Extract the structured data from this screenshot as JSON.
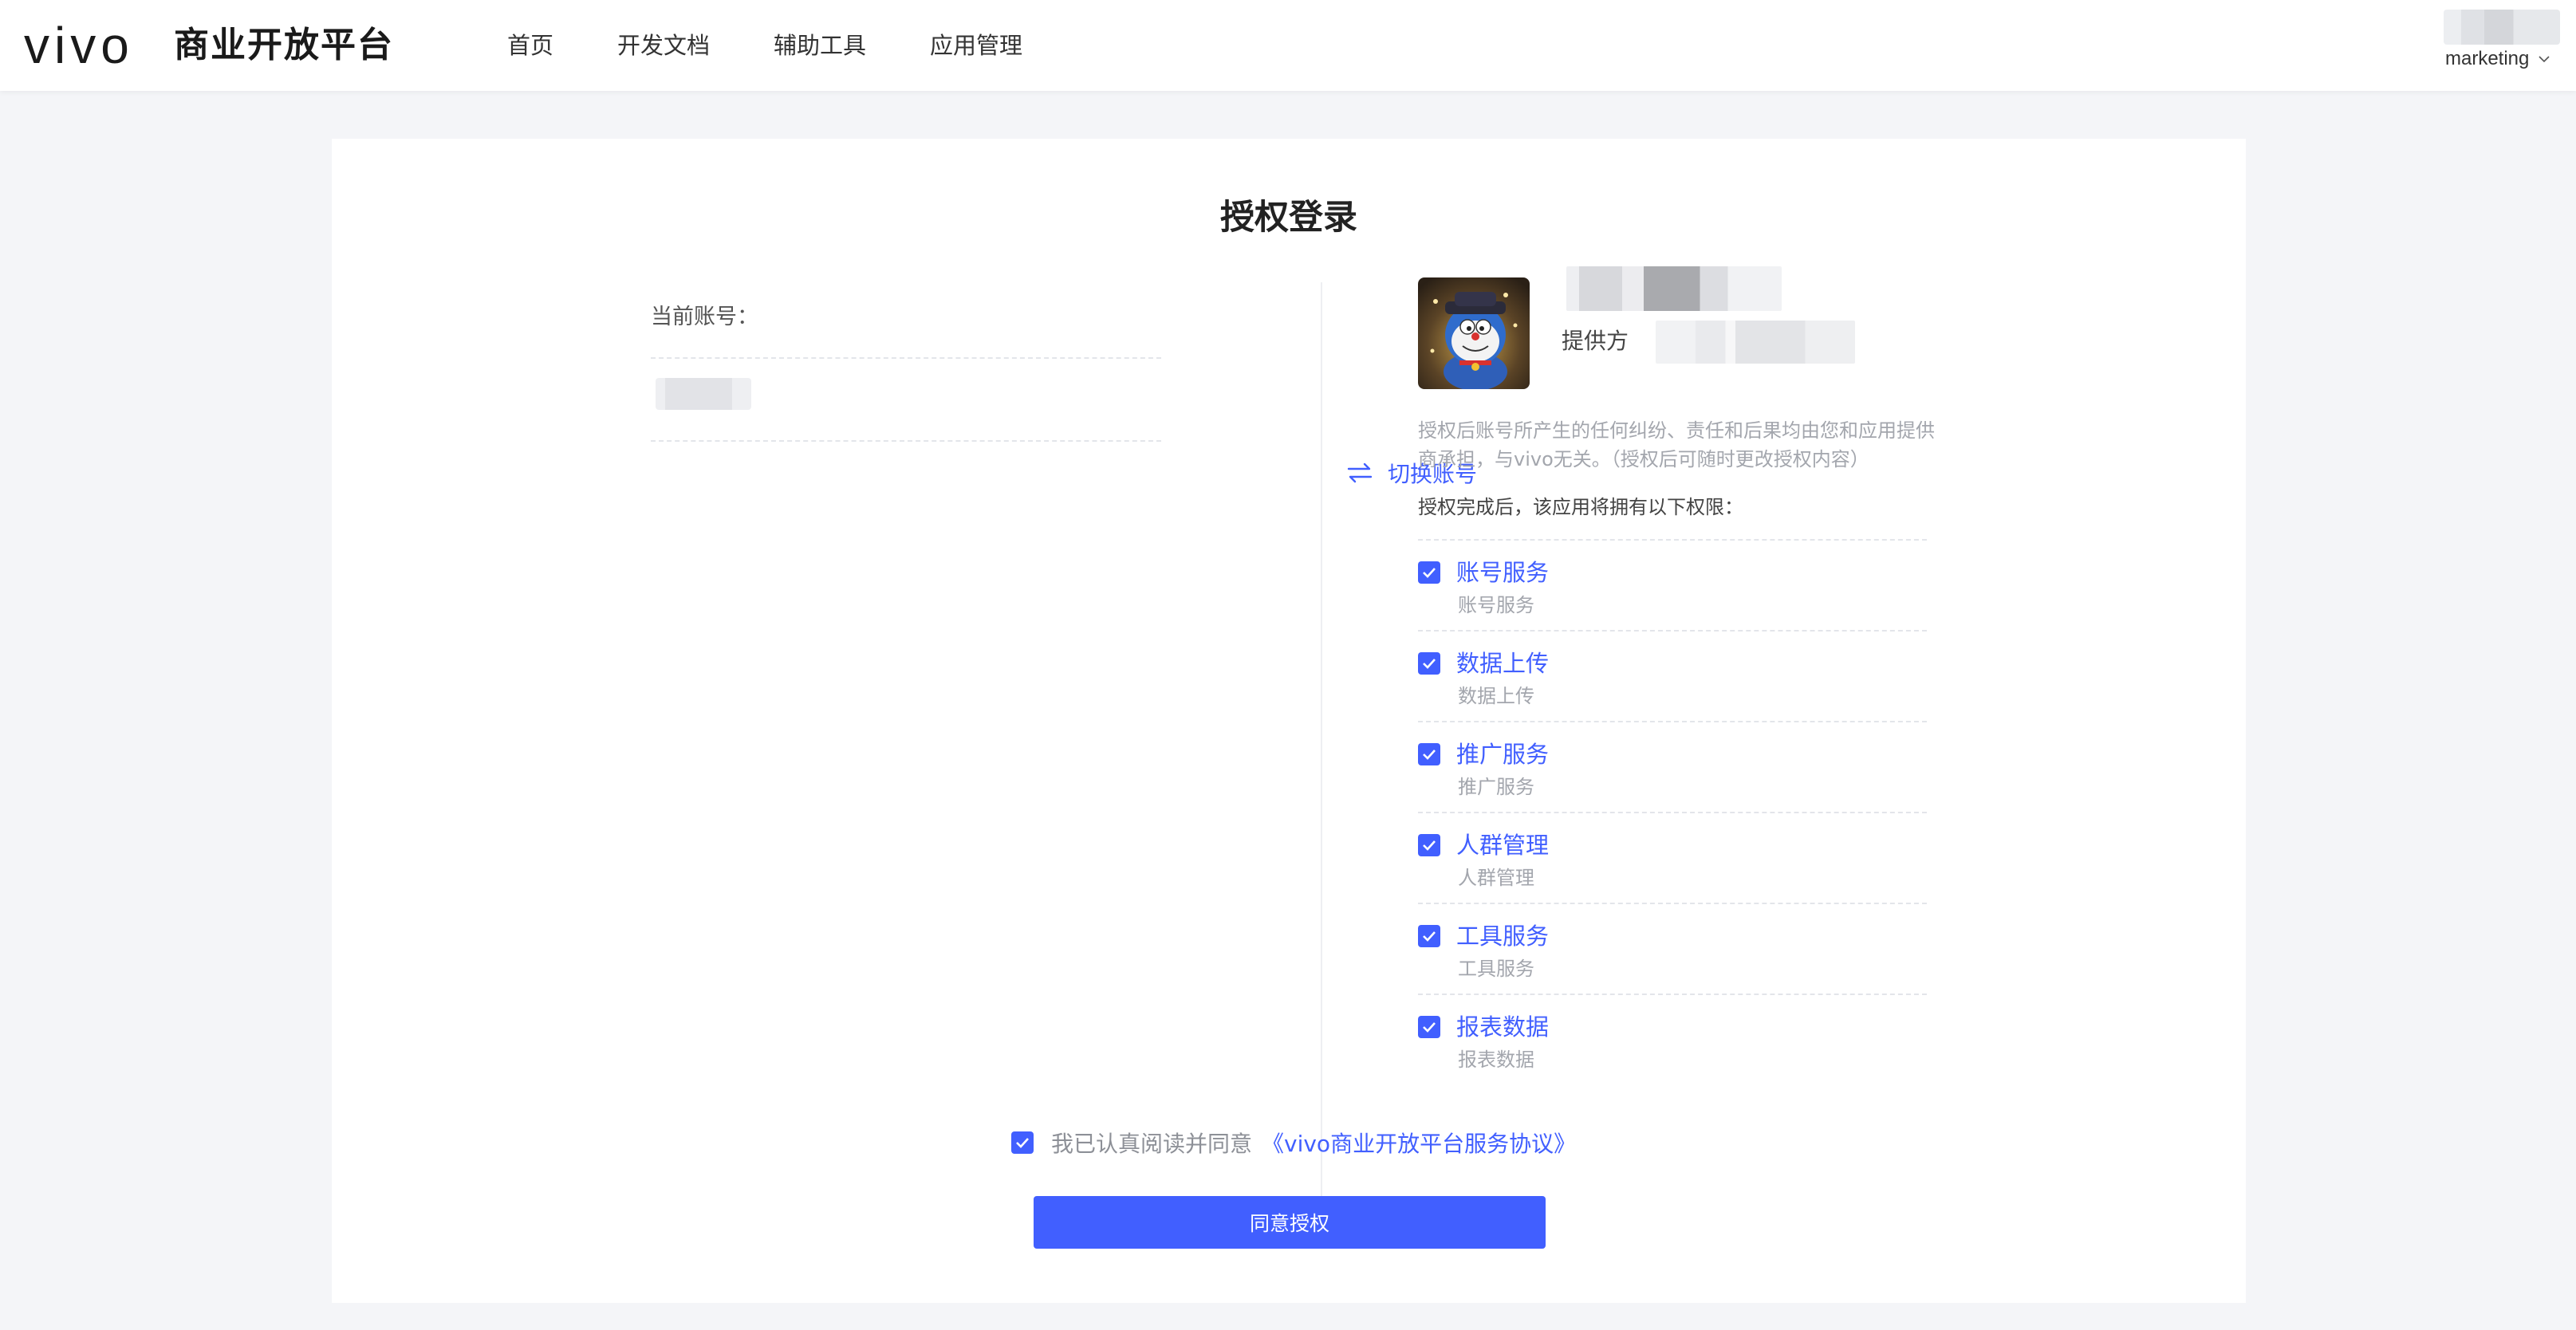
{
  "header": {
    "logo_text": "vivo",
    "platform_title": "商业开放平台",
    "nav": [
      {
        "label": "首页"
      },
      {
        "label": "开发文档"
      },
      {
        "label": "辅助工具"
      },
      {
        "label": "应用管理"
      }
    ],
    "user": "marketing"
  },
  "page": {
    "title": "授权登录",
    "current_account_label": "当前账号：",
    "switch_account_label": "切换账号",
    "provider_label": "提供方",
    "disclaimer": "授权后账号所产生的任何纠纷、责任和后果均由您和应用提供商承担，与vivo无关。（授权后可随时更改授权内容）",
    "permissions_heading": "授权完成后，该应用将拥有以下权限：",
    "permissions": [
      {
        "title": "账号服务",
        "desc": "账号服务"
      },
      {
        "title": "数据上传",
        "desc": "数据上传"
      },
      {
        "title": "推广服务",
        "desc": "推广服务"
      },
      {
        "title": "人群管理",
        "desc": "人群管理"
      },
      {
        "title": "工具服务",
        "desc": "工具服务"
      },
      {
        "title": "报表数据",
        "desc": "报表数据"
      }
    ],
    "agree_text": "我已认真阅读并同意",
    "agree_link": "《vivo商业开放平台服务协议》",
    "agree_button": "同意授权"
  },
  "colors": {
    "accent": "#415fff",
    "background": "#f4f5f8",
    "muted_text": "#a3a6ad"
  },
  "icons": [
    "switch-icon",
    "check-icon",
    "chevron-down-icon",
    "app-avatar-image"
  ]
}
